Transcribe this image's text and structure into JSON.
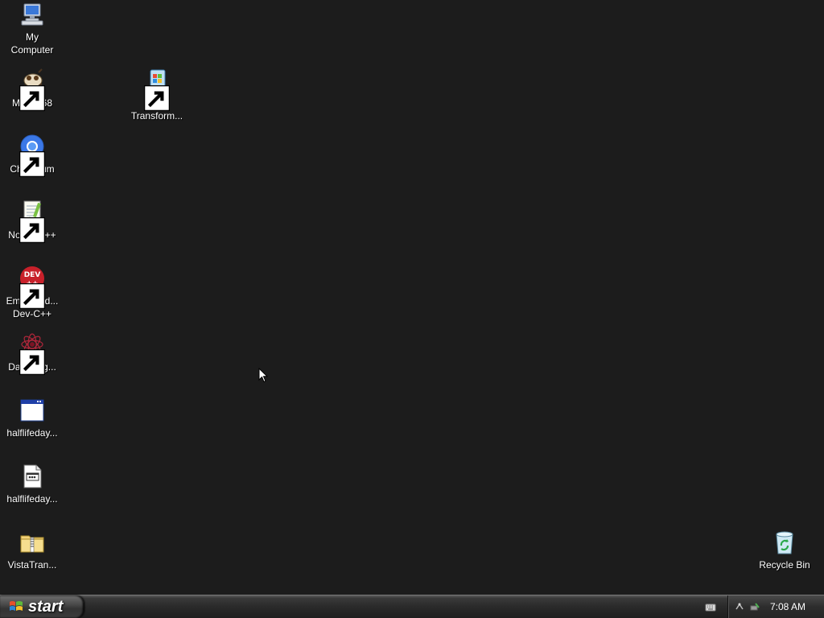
{
  "desktop": {
    "icons": [
      {
        "label": "My\nComputer",
        "icon": "my-computer-icon"
      },
      {
        "label": "MyPal 68",
        "icon": "mypal-icon"
      },
      {
        "label": "Vista\nTransform...",
        "icon": "vista-transform-icon"
      },
      {
        "label": "Chromium",
        "icon": "chromium-icon"
      },
      {
        "label": "Notepad++",
        "icon": "notepadpp-icon"
      },
      {
        "label": "Embarcad...\nDev-C++",
        "icon": "devcpp-icon"
      },
      {
        "label": "DataWag...",
        "icon": "datawag-icon"
      },
      {
        "label": "halflifeday...",
        "icon": "window-app-icon"
      },
      {
        "label": "halflifeday...",
        "icon": "document-icon"
      },
      {
        "label": "VistaTran...",
        "icon": "zip-folder-icon"
      },
      {
        "label": "Recycle Bin",
        "icon": "recycle-bin-icon"
      }
    ]
  },
  "taskbar": {
    "start_label": "start",
    "clock": "7:08 AM"
  },
  "colors": {
    "desktop_bg": "#1c1c1c",
    "taskbar_bg": "#2a2a2a"
  }
}
